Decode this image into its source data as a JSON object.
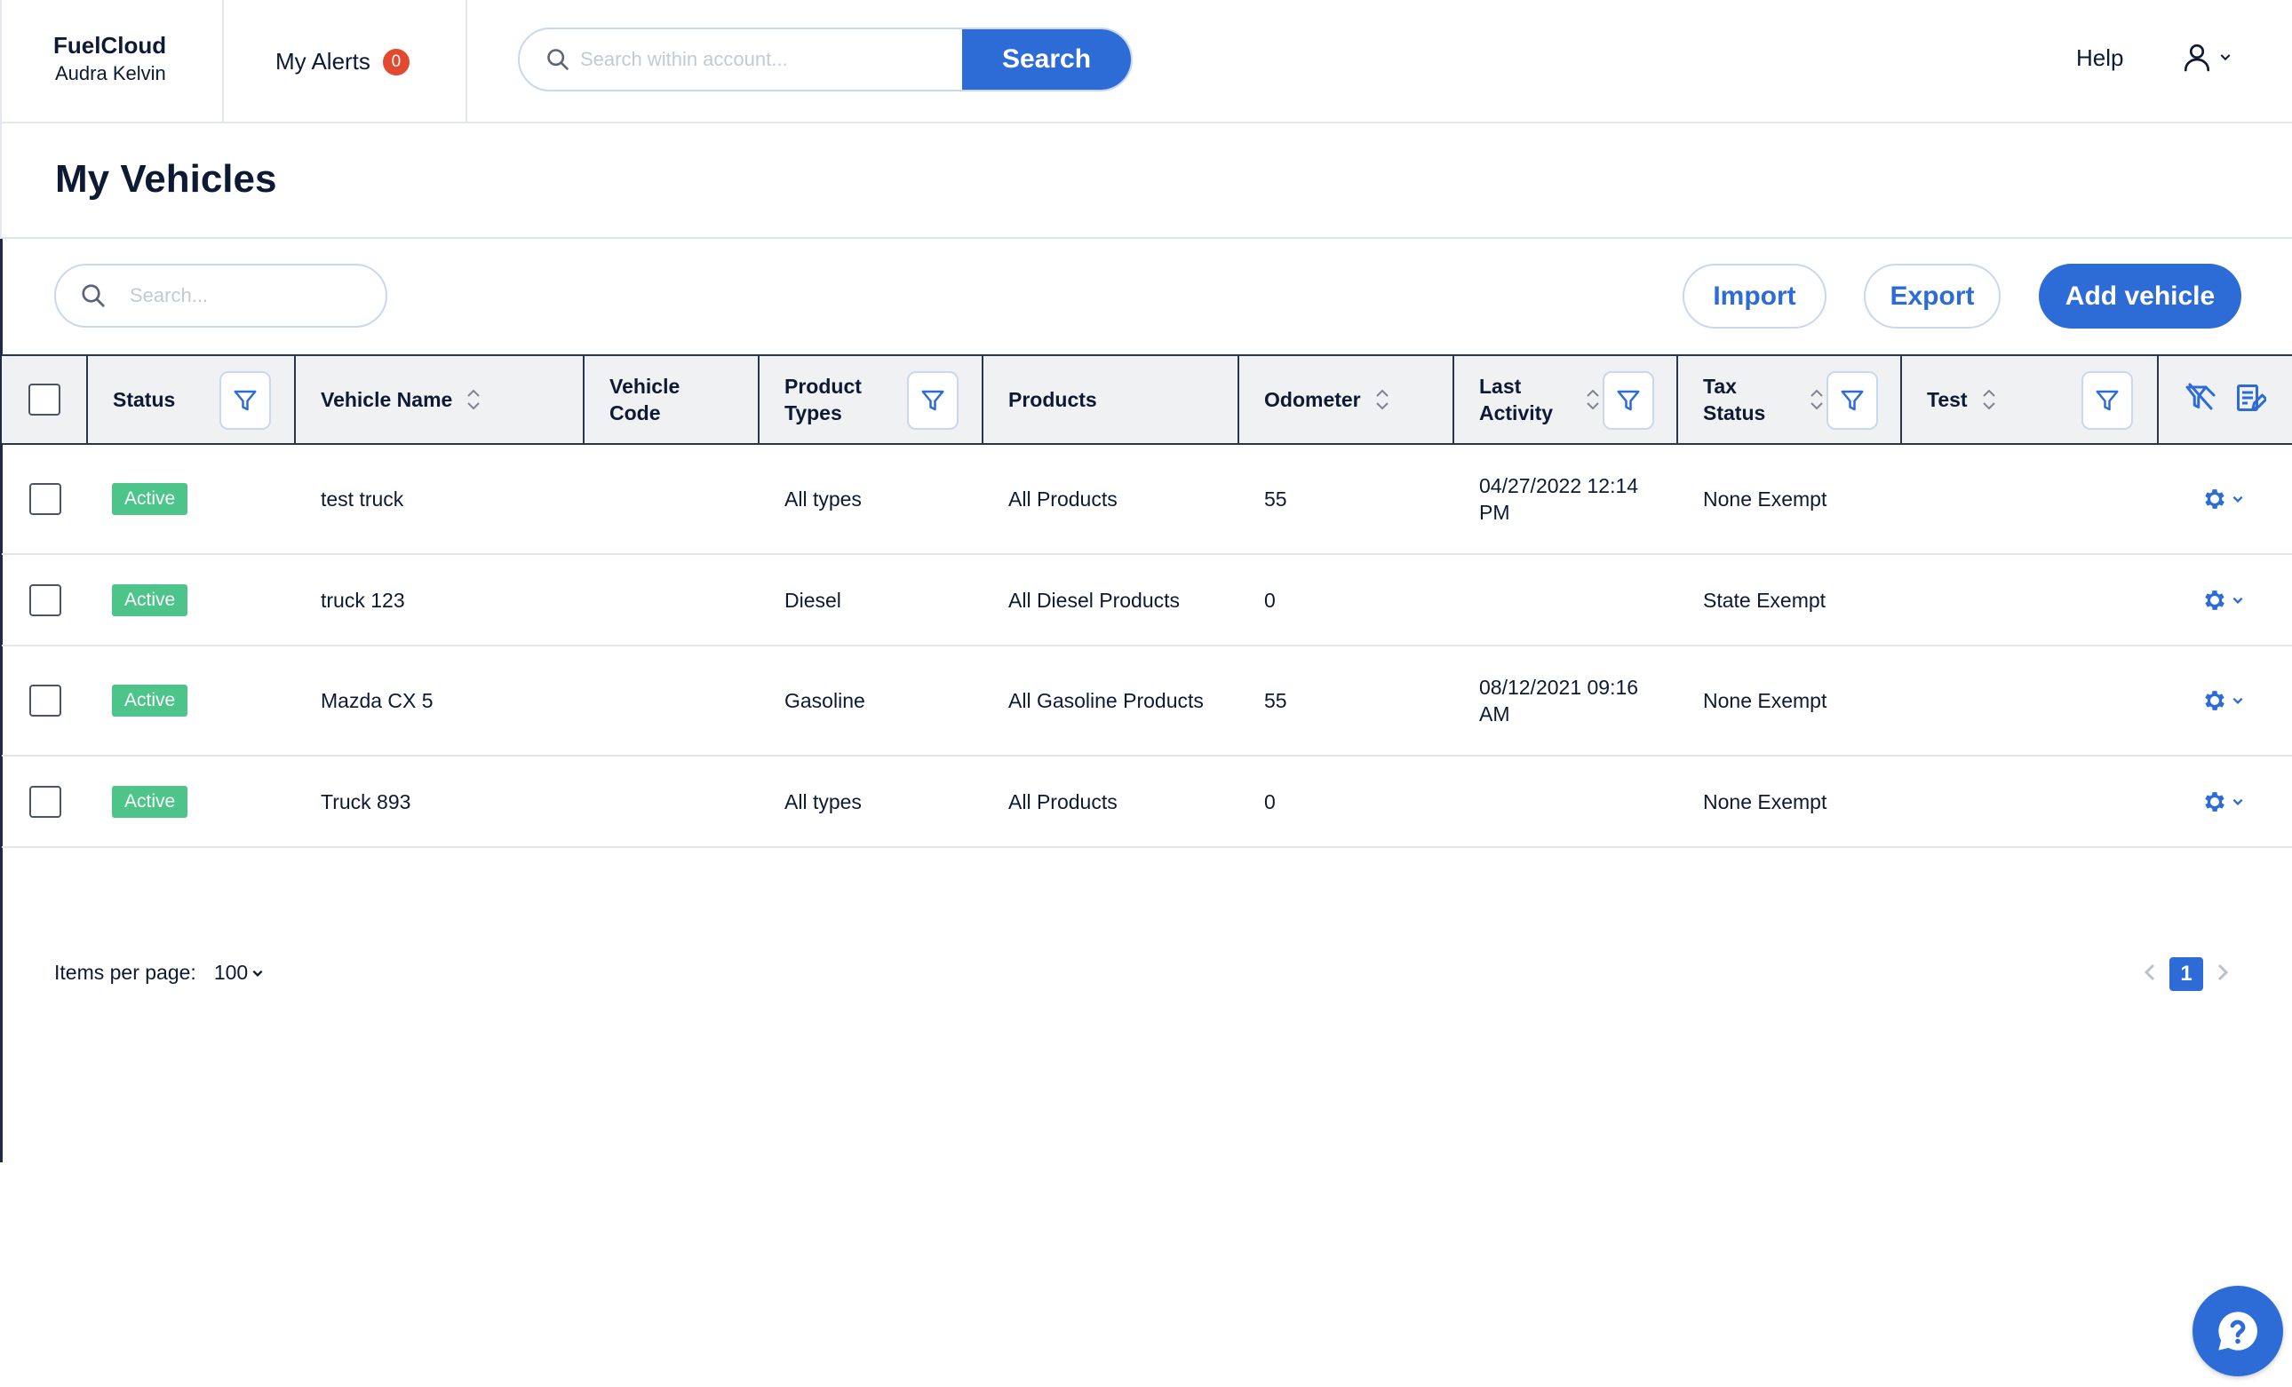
{
  "brand": {
    "name": "FuelCloud",
    "user": "Audra Kelvin"
  },
  "alerts": {
    "label": "My Alerts",
    "count": "0"
  },
  "global_search": {
    "placeholder": "Search within account...",
    "button": "Search"
  },
  "header": {
    "help": "Help"
  },
  "page": {
    "title": "My Vehicles"
  },
  "toolbar": {
    "search_placeholder": "Search...",
    "import": "Import",
    "export": "Export",
    "add_vehicle": "Add vehicle"
  },
  "table": {
    "columns": {
      "status": "Status",
      "vehicle_name": "Vehicle Name",
      "vehicle_code": "Vehicle\nCode",
      "product_types": "Product\nTypes",
      "products": "Products",
      "odometer": "Odometer",
      "last_activity": "Last\nActivity",
      "tax_status": "Tax\nStatus",
      "test": "Test"
    },
    "rows": [
      {
        "status": "Active",
        "vehicle_name": "test truck",
        "vehicle_code": "",
        "product_types": "All types",
        "products": "All Products",
        "odometer": "55",
        "last_activity": "04/27/2022 12:14\nPM",
        "tax_status": "None Exempt",
        "test": ""
      },
      {
        "status": "Active",
        "vehicle_name": "truck 123",
        "vehicle_code": "",
        "product_types": "Diesel",
        "products": "All Diesel Products",
        "odometer": "0",
        "last_activity": "",
        "tax_status": "State Exempt",
        "test": ""
      },
      {
        "status": "Active",
        "vehicle_name": "Mazda CX 5",
        "vehicle_code": "",
        "product_types": "Gasoline",
        "products": "All Gasoline Products",
        "odometer": "55",
        "last_activity": "08/12/2021 09:16\nAM",
        "tax_status": "None Exempt",
        "test": ""
      },
      {
        "status": "Active",
        "vehicle_name": "Truck 893",
        "vehicle_code": "",
        "product_types": "All types",
        "products": "All Products",
        "odometer": "0",
        "last_activity": "",
        "tax_status": "None Exempt",
        "test": ""
      }
    ]
  },
  "pagination": {
    "items_per_page_label": "Items per page:",
    "items_per_page_value": "100",
    "current_page": "1"
  },
  "colors": {
    "accent": "#2d6bd6",
    "active_badge": "#4cc48a",
    "alert_badge": "#e2492f",
    "text": "#0e1a33"
  }
}
